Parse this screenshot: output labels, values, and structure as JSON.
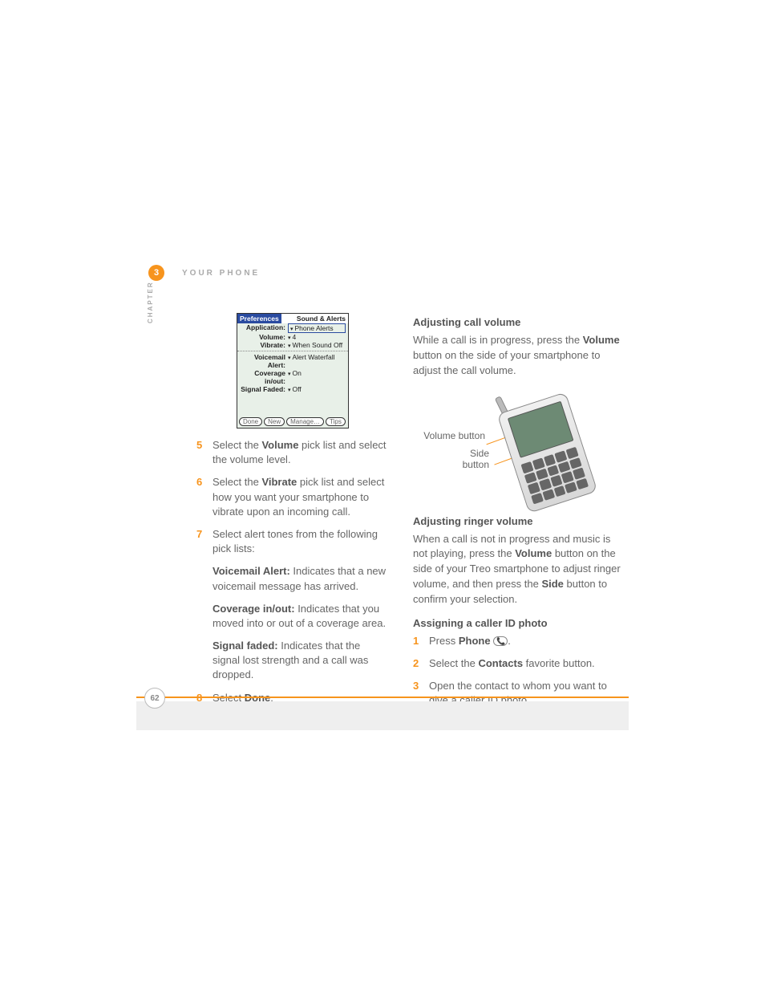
{
  "chapter": {
    "number": "3",
    "label": "CHAPTER",
    "title": "YOUR PHONE"
  },
  "pref_screenshot": {
    "title_left": "Preferences",
    "title_right": "Sound & Alerts",
    "rows": [
      {
        "label": "Application:",
        "value": "Phone Alerts",
        "boxed": true
      },
      {
        "label": "Volume:",
        "value": "4"
      },
      {
        "label": "Vibrate:",
        "value": "When Sound Off"
      }
    ],
    "rows2": [
      {
        "label": "Voicemail Alert:",
        "value": "Alert Waterfall"
      },
      {
        "label": "Coverage in/out:",
        "value": "On"
      },
      {
        "label": "Signal Faded:",
        "value": "Off"
      }
    ],
    "buttons": [
      "Done",
      "New",
      "Manage…",
      "Tips"
    ]
  },
  "left_steps": {
    "s5": {
      "num": "5",
      "pre": "Select the ",
      "bold": "Volume",
      "post": " pick list and select the volume level."
    },
    "s6": {
      "num": "6",
      "pre": "Select the ",
      "bold": "Vibrate",
      "post": " pick list and select how you want your smartphone to vibrate upon an incoming call."
    },
    "s7": {
      "num": "7",
      "text": "Select alert tones from the following pick lists:"
    },
    "sub_a": {
      "bold": "Voicemail Alert:",
      "text": " Indicates that a new voicemail message has arrived."
    },
    "sub_b": {
      "bold": "Coverage in/out:",
      "text": " Indicates that you moved into or out of a coverage area."
    },
    "sub_c": {
      "bold": "Signal faded:",
      "text": " Indicates that the signal lost strength and a call was dropped."
    },
    "s8": {
      "num": "8",
      "pre": "Select ",
      "bold": "Done",
      "post": "."
    }
  },
  "right": {
    "h1": "Adjusting call volume",
    "p1a": "While a call is in progress, press the ",
    "p1b": "Volume",
    "p1c": " button on the side of your smartphone to adjust the call volume.",
    "callout1": "Volume button",
    "callout2a": "Side",
    "callout2b": "button",
    "h2": "Adjusting ringer volume",
    "p2a": "When a call is not in progress and music is not playing, press the ",
    "p2b": "Volume",
    "p2c": " button on the side of your Treo smartphone to adjust ringer volume, and then press the ",
    "p2d": "Side",
    "p2e": " button to confirm your selection.",
    "h3": "Assigning a caller ID photo",
    "s1": {
      "num": "1",
      "pre": "Press ",
      "bold": "Phone",
      "post": " "
    },
    "s2": {
      "num": "2",
      "pre": "Select the ",
      "bold": "Contacts",
      "post": " favorite button."
    },
    "s3": {
      "num": "3",
      "text": "Open the contact to whom you want to give a caller ID photo."
    }
  },
  "page_number": "62"
}
